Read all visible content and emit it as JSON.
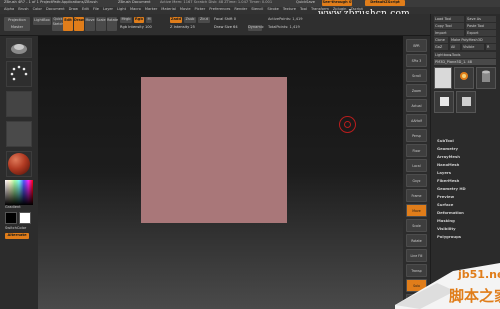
{
  "titlebar": {
    "title_left": "ZBrush 4R7 - 1 of 1 ProjectPath:Applications/ZBrush",
    "title_mid": "ZBrush Document",
    "title_mem": "Active Mem: 1167 Scratch Disk: 48 ZTime: 1.047 Timer: 0.001",
    "quicksave": "QuickSave",
    "see_through": "See-through 0",
    "default_script": "DefaultZScript",
    "watermark": "www.zbrushcn.com"
  },
  "menubar": {
    "items": [
      "Alpha",
      "Brush",
      "Color",
      "Document",
      "Draw",
      "Edit",
      "File",
      "Layer",
      "Light",
      "Macro",
      "Marker",
      "Material",
      "Movie",
      "Picker",
      "Preferences",
      "Render",
      "Stencil",
      "Stroke",
      "Texture",
      "Tool",
      "Transform",
      "Zplugin",
      "Zscript"
    ]
  },
  "toolbar": {
    "projection_master": "Projection Master",
    "lightbox": "LightBox",
    "quick_sketch": "Quick Sketch",
    "edit": "Edit",
    "draw": "Draw",
    "move": "Move",
    "scale": "Scale",
    "rotate": "Rotate",
    "mrgb": "Mrgb",
    "rgb": "Rgb",
    "m": "M",
    "rgb_intensity": "Rgb Intensity 100",
    "zadd": "Zadd",
    "zsub": "Zsub",
    "zcut": "Zcut",
    "z_intensity": "Z Intensity 25",
    "focal_shift": "Focal Shift 0",
    "draw_size": "Draw Size 64",
    "dynamic": "Dynamic",
    "active_points": "ActivePoints: 1,419",
    "total_points": "TotalPoints: 1,419",
    "version": "4.2.2"
  },
  "leftshelf": {
    "gradient": "Gradient",
    "switch_color": "SwitchColor",
    "alternate": "Alternate"
  },
  "rightshelf": {
    "items": [
      "BPR",
      "SPix 3",
      "Scroll",
      "Zoom",
      "Actual",
      "AAHalf",
      "Persp",
      "Floor",
      "Local",
      "Gxyz",
      "Frame",
      "Move",
      "Scale",
      "Rotate",
      "Line Fill",
      "Transp",
      "Solo",
      "Xpose"
    ]
  },
  "tray": {
    "load_tool": "Load Tool",
    "save_as": "Save As",
    "copy_tool": "Copy Tool",
    "paste_tool": "Paste Tool",
    "import": "Import",
    "export": "Export",
    "clone": "Clone",
    "make_polymesh": "Make PolyMesh3D",
    "goz": "GoZ",
    "all": "All",
    "visible": "Visible",
    "r": "R",
    "lightbox_tools": "Lightbox▸Tools",
    "tool_name": "PM3D_Plane3D_1. 48",
    "subtool_thumbs": [
      "PM3D_Plane3D",
      "SimpleBrush",
      "Cylinder3D",
      "PM3D_Plane3D",
      "PM3D_Plane3D"
    ],
    "subpalettes": [
      "SubTool",
      "Geometry",
      "ArrayMesh",
      "NanoMesh",
      "Layers",
      "FiberMesh",
      "Geometry HD",
      "Preview",
      "Surface",
      "Deformation",
      "Masking",
      "Visibility",
      "Polygroups"
    ]
  },
  "site_watermark": {
    "domain": "jb51.net",
    "cn": "脚本之家"
  },
  "colors": {
    "accent": "#e07d1a",
    "plane": "#a97779",
    "cursor": "#b81d1d"
  }
}
